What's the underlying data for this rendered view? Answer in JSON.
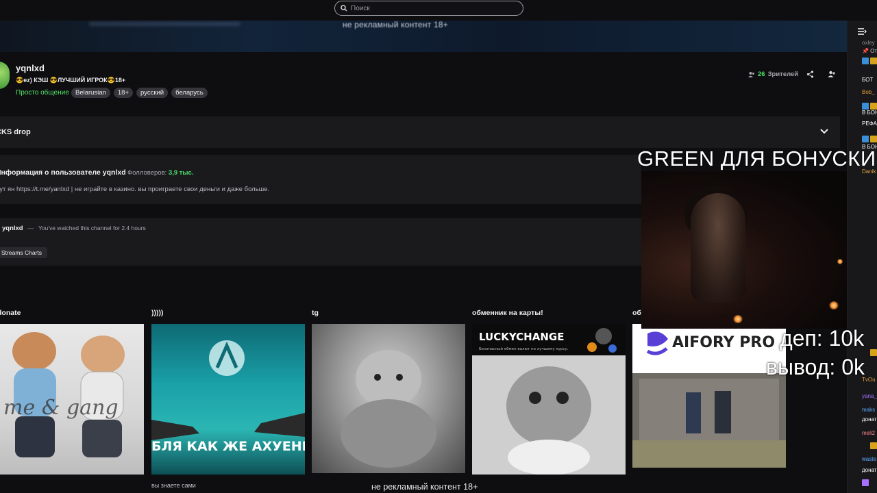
{
  "search": {
    "placeholder": "Поиск"
  },
  "banner": {
    "text": "не рекламный контент 18+"
  },
  "channel": {
    "name": "yqnlxd",
    "title": "😎ez) КЭШ 😎ЛУЧШИЙ ИГРОК😎18+",
    "category": "Просто общение",
    "tags": [
      "Belarusian",
      "18+",
      "русский",
      "беларусь"
    ],
    "viewers_count": "26",
    "viewers_label": "Зрителей"
  },
  "drop": {
    "label": "CKS drop"
  },
  "about": {
    "title": "Информация о пользователе yqnlxd",
    "followers_label": "Фолловеров:",
    "followers_value": "3,9 тыс.",
    "description": "нут ян https://t.me/yanlxd | не играйте в казино. вы проиграете свои деньги и даже больше."
  },
  "watch": {
    "name": "yqnlxd",
    "separator": "—",
    "text": "You've watched this channel for 2.4 hours",
    "streams_button": "Streams Charts"
  },
  "cards": [
    {
      "title": "donate",
      "subtitle": "",
      "image_text": "me & gang"
    },
    {
      "title": ")))))",
      "subtitle": "вы знаете сами",
      "image_text": "БЛЯ КАК ЖЕ АХУЕННО ANORA VPN"
    },
    {
      "title": "tg",
      "subtitle": "",
      "image_text": ""
    },
    {
      "title": "обменник на карты!",
      "subtitle": "",
      "image_text": "LUCKYCHANGE",
      "image_subtext": "Безопасный обмен валют по лучшему курсу."
    },
    {
      "title": "об",
      "subtitle": "",
      "image_text": "AIFORY PRO"
    }
  ],
  "overlay": {
    "green_text": "GREEN ДЛЯ БОНУСКИ",
    "dep_text": "деп: 10k",
    "vyvod_text": "вывод: 0k",
    "bottom_text": "не рекламный контент 18+"
  },
  "chat": {
    "lines": [
      {
        "text": "oxley",
        "color": "#888888"
      },
      {
        "text": "📌 Отк",
        "color": "#cccccc"
      },
      {
        "text": "БОТ",
        "color": "#ffffff"
      },
      {
        "text": "Bob_",
        "color": "#e0a13a"
      },
      {
        "text": "В БОН",
        "color": "#ffffff"
      },
      {
        "text": "РЕФА",
        "color": "#ffffff"
      },
      {
        "text": "В БОН",
        "color": "#ffffff"
      },
      {
        "text": "Danik",
        "color": "#e0a13a"
      },
      {
        "text": "TvOu",
        "color": "#e0a13a"
      },
      {
        "text": "yana_",
        "color": "#a970ff"
      },
      {
        "text": "maks",
        "color": "#5aa9ff"
      },
      {
        "text": "донат",
        "color": "#ffffff"
      },
      {
        "text": "meli2",
        "color": "#ff8a8a"
      },
      {
        "text": "waste",
        "color": "#5aa9ff"
      },
      {
        "text": "донат",
        "color": "#ffffff"
      }
    ]
  },
  "colors": {
    "accent_green": "#4ee26c",
    "panel": "#1a1a1d",
    "bg": "#0e0e10"
  }
}
